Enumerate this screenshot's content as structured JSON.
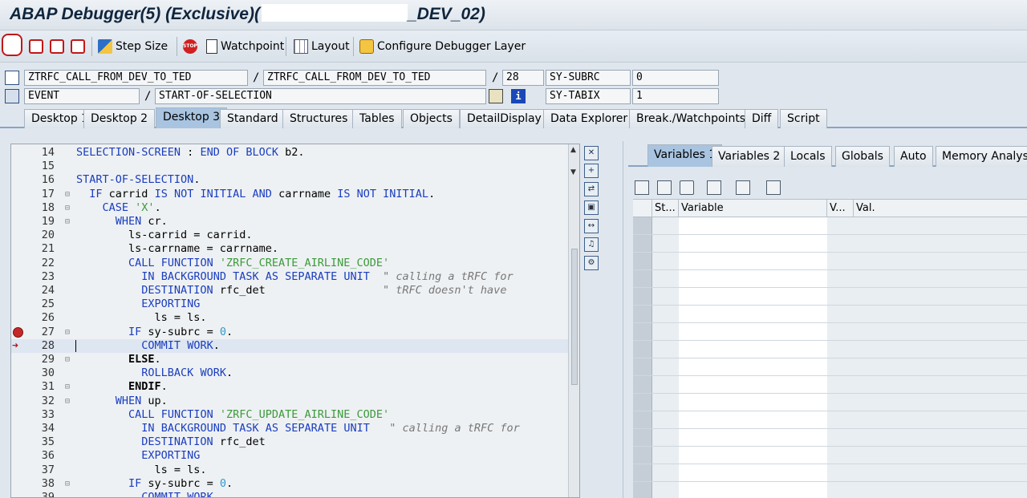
{
  "window": {
    "title_prefix": "ABAP Debugger(5)  (Exclusive)(",
    "title_suffix": "_DEV_02)"
  },
  "toolbar": {
    "step_size": "Step Size",
    "watchpoint": "Watchpoint",
    "layout": "Layout",
    "configure": "Configure Debugger Layer"
  },
  "info": {
    "program": "ZTRFC_CALL_FROM_DEV_TO_TED",
    "include": "ZTRFC_CALL_FROM_DEV_TO_TED",
    "line": "28",
    "event_type": "EVENT",
    "event_name": "START-OF-SELECTION",
    "sys1_name": "SY-SUBRC",
    "sys1_value": "0",
    "sys2_name": "SY-TABIX",
    "sys2_value": "1",
    "slash": "/"
  },
  "tabs": [
    "Desktop 1",
    "Desktop 2",
    "Desktop 3",
    "Standard",
    "Structures",
    "Tables",
    "Objects",
    "DetailDisplay",
    "Data Explorer",
    "Break./Watchpoints",
    "Diff",
    "Script"
  ],
  "code": [
    {
      "n": "14",
      "t": "SELECTION-SCREEN : END OF BLOCK b2."
    },
    {
      "n": "15",
      "t": ""
    },
    {
      "n": "16",
      "t": "START-OF-SELECTION."
    },
    {
      "n": "17",
      "t": "  IF carrid IS NOT INITIAL AND carrname IS NOT INITIAL."
    },
    {
      "n": "18",
      "t": "    CASE 'X'."
    },
    {
      "n": "19",
      "t": "      WHEN cr."
    },
    {
      "n": "20",
      "t": "        ls-carrid = carrid."
    },
    {
      "n": "21",
      "t": "        ls-carrname = carrname."
    },
    {
      "n": "22",
      "t": "        CALL FUNCTION 'ZRFC_CREATE_AIRLINE_CODE'"
    },
    {
      "n": "23",
      "t": "          IN BACKGROUND TASK AS SEPARATE UNIT  \" calling a tRFC for"
    },
    {
      "n": "24",
      "t": "          DESTINATION rfc_det                  \" tRFC doesn't have"
    },
    {
      "n": "25",
      "t": "          EXPORTING"
    },
    {
      "n": "26",
      "t": "            ls = ls."
    },
    {
      "n": "27",
      "t": "        IF sy-subrc = 0."
    },
    {
      "n": "28",
      "t": "          COMMIT WORK."
    },
    {
      "n": "29",
      "t": "        ELSE."
    },
    {
      "n": "30",
      "t": "          ROLLBACK WORK."
    },
    {
      "n": "31",
      "t": "        ENDIF."
    },
    {
      "n": "32",
      "t": "      WHEN up."
    },
    {
      "n": "33",
      "t": "        CALL FUNCTION 'ZRFC_UPDATE_AIRLINE_CODE'"
    },
    {
      "n": "34",
      "t": "          IN BACKGROUND TASK AS SEPARATE UNIT   \" calling a tRFC for"
    },
    {
      "n": "35",
      "t": "          DESTINATION rfc_det"
    },
    {
      "n": "36",
      "t": "          EXPORTING"
    },
    {
      "n": "37",
      "t": "            ls = ls."
    },
    {
      "n": "38",
      "t": "        IF sy-subrc = 0."
    },
    {
      "n": "39",
      "t": "          COMMIT WORK."
    }
  ],
  "current_line": "28",
  "breakpoint_line": "27",
  "var_tabs": [
    "Variables 1",
    "Variables 2",
    "Locals",
    "Globals",
    "Auto",
    "Memory Analysis"
  ],
  "var_columns": [
    "St...",
    "Variable",
    "V...",
    "Val."
  ],
  "colors": {
    "keyword": "#1a3dbf",
    "string": "#3c9a3c",
    "number": "#3399cc",
    "comment": "#777777",
    "active_tab": "#a8c4e0"
  }
}
